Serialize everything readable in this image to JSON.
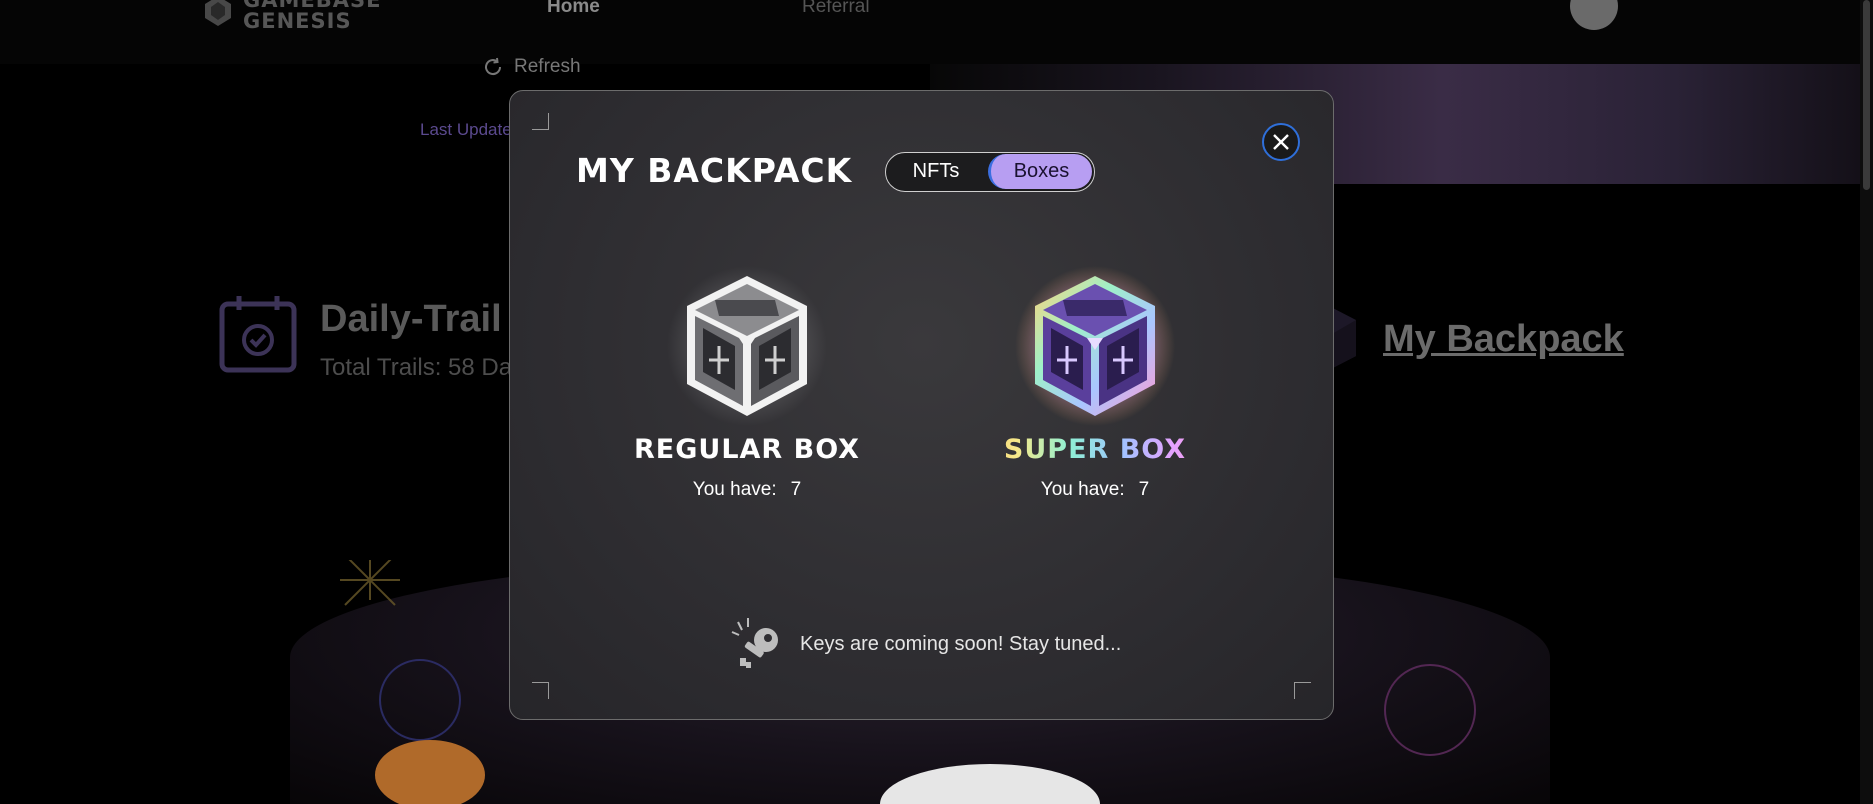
{
  "nav": {
    "logo_line1": "GAMEBASE",
    "logo_line2": "GENESIS",
    "home": "Home",
    "referral": "Referral"
  },
  "page": {
    "refresh": "Refresh",
    "last_updated": "Last Update",
    "trail_title": "Daily-Trail L",
    "trail_sub": "Total Trails: 58 Da",
    "my_backpack": "My Backpack"
  },
  "modal": {
    "title": "MY BACKPACK",
    "tabs": [
      {
        "label": "NFTs",
        "active": false
      },
      {
        "label": "Boxes",
        "active": true
      }
    ],
    "boxes": [
      {
        "name": "REGULAR BOX",
        "have_label": "You have:",
        "count": "7",
        "icon": "regular-box-icon"
      },
      {
        "name": "SUPER BOX",
        "have_label": "You have:",
        "count": "7",
        "icon": "super-box-icon"
      }
    ],
    "keys_notice": "Keys are coming soon! Stay tuned..."
  },
  "colors": {
    "accent_purple": "#b79ef2",
    "close_ring": "#2f6fd9",
    "modal_bg": "#2f2e32"
  }
}
